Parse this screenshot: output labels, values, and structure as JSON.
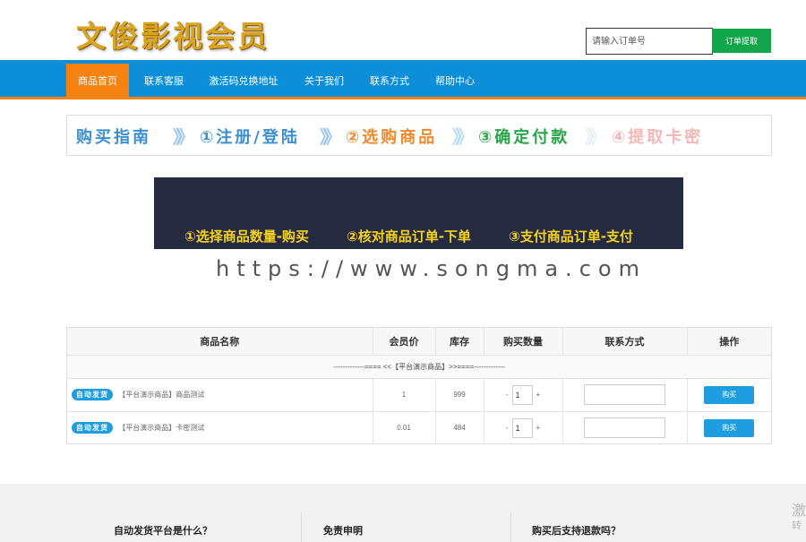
{
  "header": {
    "logo_text": "文俊影视会员",
    "search_placeholder": "请输入订单号",
    "search_button": "订单提取"
  },
  "nav": {
    "items": [
      "商品首页",
      "联系客服",
      "激活码兑换地址",
      "关于我们",
      "联系方式",
      "帮助中心"
    ],
    "active_index": 0
  },
  "guide": {
    "title": "购买指南",
    "steps": [
      "①注册/登陆",
      "②选购商品",
      "③确定付款",
      "④提取卡密"
    ],
    "colors": {
      "title": "#3a8fd1",
      "step1": "#3a8fd1",
      "step2": "#f2892a",
      "step3": "#27a549",
      "step4": "#f4b7b7"
    }
  },
  "banner": {
    "steps": [
      "①选择商品数量-购买",
      "②核对商品订单-下单",
      "③支付商品订单-支付"
    ]
  },
  "watermark": "https://www.songma.com",
  "table": {
    "headers": [
      "商品名称",
      "会员价",
      "库存",
      "购买数量",
      "联系方式",
      "操作"
    ],
    "group_label": "-------------==== <<【平台演示商品】>>====-------------",
    "rows": [
      {
        "badge": "自动发货",
        "name": "【平台演示商品】商品测试",
        "price": "1",
        "stock": "999",
        "qty": "1",
        "action": "购买"
      },
      {
        "badge": "自动发货",
        "name": "【平台演示商品】卡密测试",
        "price": "0.01",
        "stock": "484",
        "qty": "1",
        "action": "购买"
      }
    ],
    "qty_minus": "-",
    "qty_plus": "+"
  },
  "footer": {
    "faq": [
      "自动发货平台是什么？",
      "免责申明",
      "购买后支持退款吗？"
    ],
    "corner": [
      "激",
      "转"
    ]
  }
}
